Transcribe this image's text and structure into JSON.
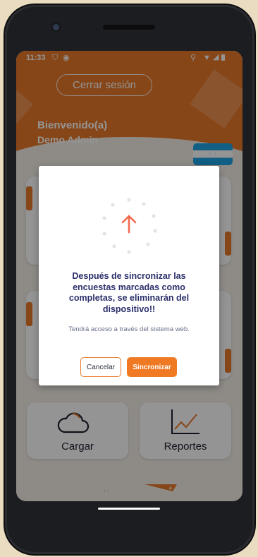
{
  "status_bar": {
    "time": "11:33",
    "icons": [
      "shield-icon",
      "circle-icon",
      "location-icon",
      "wifi-icon",
      "signal-icon",
      "battery-icon"
    ]
  },
  "header": {
    "logout_label": "Cerrar sesión",
    "welcome_label": "Bienvenido(a)",
    "user_name": "Demo Admin",
    "flag_icon": "honduras-flag-icon"
  },
  "cards": {
    "upload_label": "Cargar",
    "reports_label": "Reportes",
    "upload_icon": "cloud-icon",
    "reports_icon": "line-chart-icon"
  },
  "dialog": {
    "icon": "upload-arrow-icon",
    "message": "Después de sincronizar las encuestas marcadas como completas, se eliminarán del dispositivo!!",
    "note": "Tendrá acceso a través del sistema web.",
    "cancel_label": "Cancelar",
    "sync_label": "Sincronizar"
  },
  "colors": {
    "brand_orange": "#e8792a",
    "dialog_text": "#2b2f6a",
    "overlay": "rgba(0,0,0,0.42)"
  }
}
